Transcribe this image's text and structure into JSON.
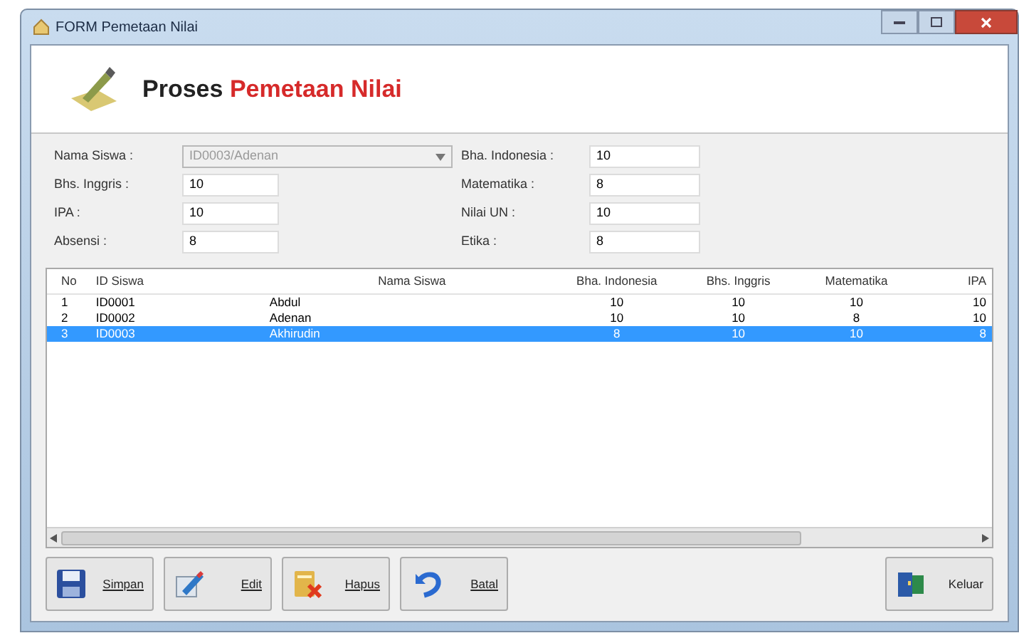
{
  "window": {
    "title": "FORM Pemetaan Nilai"
  },
  "header": {
    "title_part1": "Proses",
    "title_part2": "Pemetaan Nilai"
  },
  "form": {
    "left": [
      {
        "label": "Nama Siswa :",
        "value": "ID0003/Adenan",
        "kind": "combo",
        "disabled": true
      },
      {
        "label": "Bhs. Inggris :",
        "value": "10",
        "kind": "text",
        "disabled": false
      },
      {
        "label": "IPA :",
        "value": "10",
        "kind": "text",
        "disabled": false
      },
      {
        "label": "Absensi :",
        "value": "8",
        "kind": "text",
        "disabled": false
      }
    ],
    "right": [
      {
        "label": "Bha. Indonesia :",
        "value": "10",
        "kind": "text",
        "disabled": false
      },
      {
        "label": "Matematika :",
        "value": "8",
        "kind": "text",
        "disabled": false
      },
      {
        "label": "Nilai UN :",
        "value": "10",
        "kind": "text",
        "disabled": false
      },
      {
        "label": "Etika :",
        "value": "8",
        "kind": "text",
        "disabled": false
      }
    ]
  },
  "table": {
    "columns": [
      "No",
      "ID Siswa",
      "Nama Siswa",
      "Bha. Indonesia",
      "Bhs. Inggris",
      "Matematika",
      "IPA"
    ],
    "rows": [
      {
        "cells": [
          "1",
          "ID0001",
          "Abdul",
          "10",
          "10",
          "10",
          "10"
        ],
        "selected": false
      },
      {
        "cells": [
          "2",
          "ID0002",
          "Adenan",
          "10",
          "10",
          "8",
          "10"
        ],
        "selected": false
      },
      {
        "cells": [
          "3",
          "ID0003",
          "Akhirudin",
          "8",
          "10",
          "10",
          "8"
        ],
        "selected": true
      }
    ]
  },
  "buttons": [
    {
      "label": "Simpan",
      "kind": "save"
    },
    {
      "label": "Edit",
      "kind": "edit"
    },
    {
      "label": "Hapus",
      "kind": "delete"
    },
    {
      "label": "Batal",
      "kind": "undo"
    }
  ],
  "exit_button": {
    "label": "Keluar",
    "kind": "exit"
  }
}
